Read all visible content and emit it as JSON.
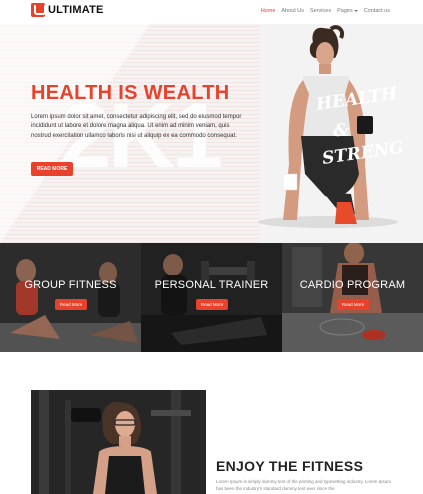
{
  "brand": {
    "name": "ULTIMATE",
    "accent": "#e8412c"
  },
  "nav": {
    "items": [
      {
        "label": "Home",
        "active": true
      },
      {
        "label": "About Us",
        "active": false
      },
      {
        "label": "Services",
        "active": false
      },
      {
        "label": "Pages",
        "active": false
      },
      {
        "label": "Contact us",
        "active": false
      }
    ]
  },
  "hero": {
    "title": "HEALTH IS WEALTH",
    "background_text": "2K1",
    "paragraph": "Lorem ipsum dolor sit amet, consectetur adipiscing elit, sed do eiusmod tempor incididunt ut labore et dolore magna aliqua. Ut enim ad minim veniam, quis nostrud exercitation ullamco laboris nisi ut aliquip ex ea commodo consequat.",
    "button": "READ MORE",
    "image_lettering": [
      "HEALTH",
      "&",
      "STRENGTH"
    ]
  },
  "features": [
    {
      "title": "GROUP FITNESS",
      "button": "Read More"
    },
    {
      "title": "PERSONAL TRAINER",
      "button": "Read More"
    },
    {
      "title": "CARDIO PROGRAM",
      "button": "Read More"
    }
  ],
  "about": {
    "title": "ENJOY THE FITNESS",
    "paragraph": "Lorem Ipsum is simply dummy text of the printing and typesetting industry. Lorem Ipsum has been the industry's standard dummy text ever since the"
  }
}
